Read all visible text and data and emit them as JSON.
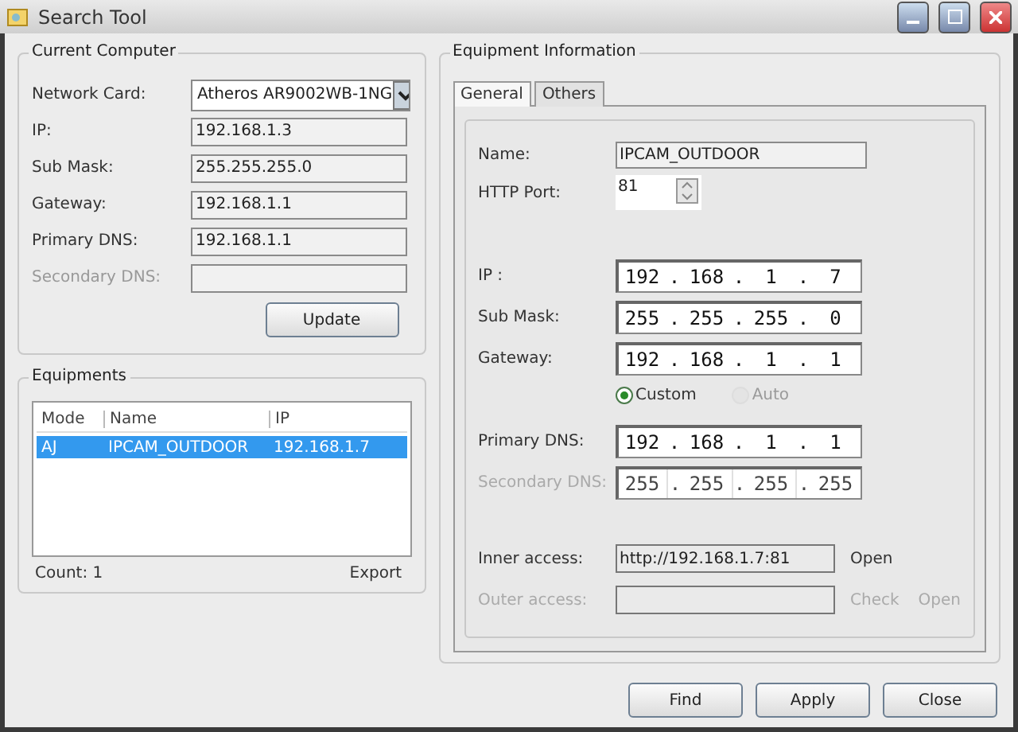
{
  "window": {
    "title": "Search Tool"
  },
  "current_computer": {
    "title": "Current Computer",
    "fields": [
      {
        "label": "Network Card:",
        "value": "Atheros AR9002WB-1NG",
        "kind": "select",
        "disabled": false
      },
      {
        "label": "IP:",
        "value": "192.168.1.3",
        "kind": "text",
        "disabled": false
      },
      {
        "label": "Sub Mask:",
        "value": "255.255.255.0",
        "kind": "text",
        "disabled": false
      },
      {
        "label": "Gateway:",
        "value": "192.168.1.1",
        "kind": "text",
        "disabled": false
      },
      {
        "label": "Primary DNS:",
        "value": "192.168.1.1",
        "kind": "text",
        "disabled": false
      },
      {
        "label": "Secondary DNS:",
        "kind": "text",
        "disabled": true
      }
    ],
    "button": "Update"
  },
  "equipments": {
    "title": "Equipments",
    "columns": [
      "Mode",
      "Name",
      "IP"
    ],
    "rows": [
      {
        "cells": [
          "AJ",
          "IPCAM_OUTDOOR",
          "192.168.1.7"
        ],
        "selected": true
      }
    ],
    "count": "Count: 1",
    "export": "Export"
  },
  "equipment_info": {
    "title": "Equipment Information",
    "tabs": [
      {
        "label": "General",
        "selected": true
      },
      {
        "label": "Others",
        "selected": false
      }
    ],
    "name": {
      "label": "Name:",
      "value": "IPCAM_OUTDOOR"
    },
    "http_port": {
      "label": "HTTP Port:",
      "value": "81"
    },
    "address_fields": [
      {
        "label": "IP  :",
        "octets": [
          "192",
          ".",
          "168",
          ".",
          "1",
          ".",
          "7"
        ],
        "disabled": false
      },
      {
        "label": "Sub Mask:",
        "octets": [
          "255",
          ".",
          "255",
          ".",
          "255",
          ".",
          "0"
        ],
        "disabled": false
      },
      {
        "label": "Gateway:",
        "octets": [
          "192",
          ".",
          "168",
          ".",
          "1",
          ".",
          "1"
        ],
        "disabled": false
      }
    ],
    "dns_mode": [
      {
        "label": "Custom",
        "selected": true,
        "disabled": false
      },
      {
        "label": "Auto",
        "selected": false,
        "disabled": true
      }
    ],
    "dns_fields": [
      {
        "label": "Primary DNS:",
        "octets": [
          "192",
          ".",
          "168",
          ".",
          "1",
          ".",
          "1"
        ],
        "disabled": false
      },
      {
        "label": "Secondary DNS:",
        "octets": [
          "255",
          ".",
          "255",
          ".",
          "255",
          ".",
          "255"
        ],
        "disabled": true
      }
    ],
    "access": [
      {
        "label": "Inner access:",
        "value": "http://192.168.1.7:81",
        "disabled": false,
        "actions": [
          {
            "label": "Open",
            "disabled": false
          }
        ]
      },
      {
        "label": "Outer access:",
        "disabled": true,
        "actions": [
          {
            "label": "Check",
            "disabled": true
          },
          {
            "label": "Open",
            "disabled": true
          }
        ]
      }
    ]
  },
  "buttons": [
    "Find",
    "Apply",
    "Close"
  ]
}
